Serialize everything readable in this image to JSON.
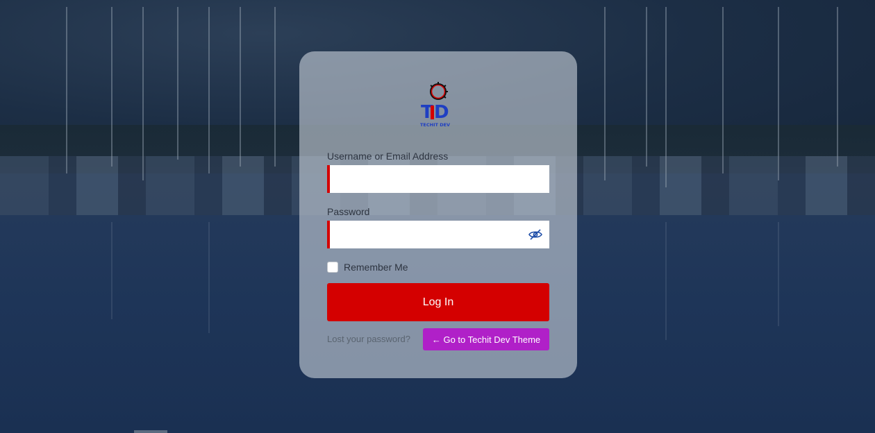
{
  "brand": {
    "logo_icon": "techit-dev-logo",
    "logo_text": "TECHIT DEV",
    "colors": {
      "red": "#d40000",
      "blue": "#1f3fc2",
      "purple": "#b020c8"
    }
  },
  "form": {
    "username_label": "Username or Email Address",
    "username_value": "",
    "password_label": "Password",
    "password_value": "",
    "password_toggle_icon": "eye-slash-icon",
    "remember_label": "Remember Me",
    "remember_checked": false,
    "submit_label": "Log In"
  },
  "links": {
    "lost_password": "Lost your password?",
    "back_to_site": "← Go to Techit Dev Theme"
  }
}
